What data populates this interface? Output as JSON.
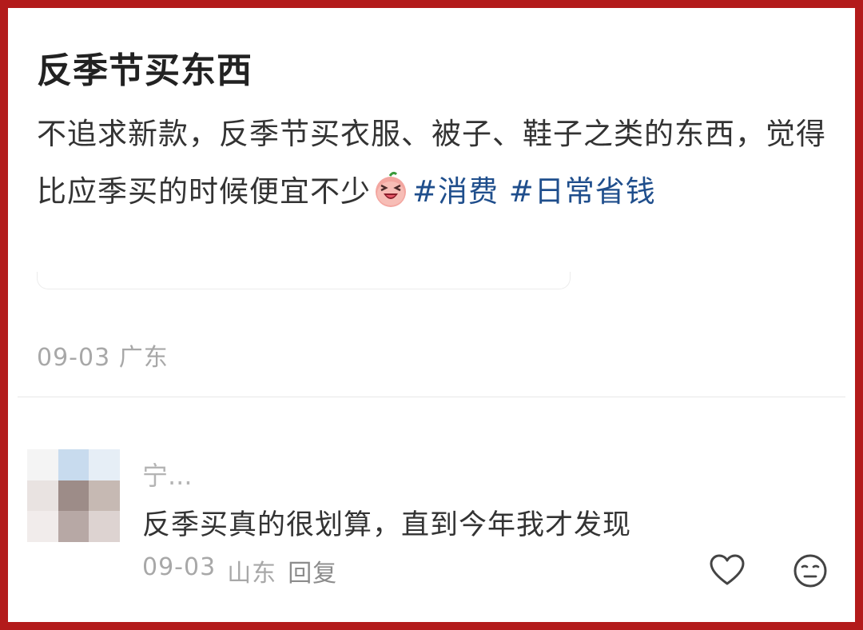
{
  "post": {
    "title": "反季节买东西",
    "body_text": "不追求新款，反季节买衣服、被子、鞋子之类的东西，觉得比应季买的时候便宜不少",
    "emoji_icon": "laughing-emoji",
    "hashtags": [
      "#消费",
      "#日常省钱"
    ],
    "date": "09-03",
    "location": "广东"
  },
  "comment": {
    "user_name": "宁...",
    "text": "反季买真的很划算，直到今年我才发现",
    "date": "09-03",
    "location": "山东",
    "reply_label": "回复",
    "like_icon": "heart-icon",
    "dislike_icon": "meh-face-icon"
  },
  "colors": {
    "frame_border": "#b31b1b",
    "hashtag": "#1f4e8c",
    "meta_text": "#a8a8a8"
  }
}
